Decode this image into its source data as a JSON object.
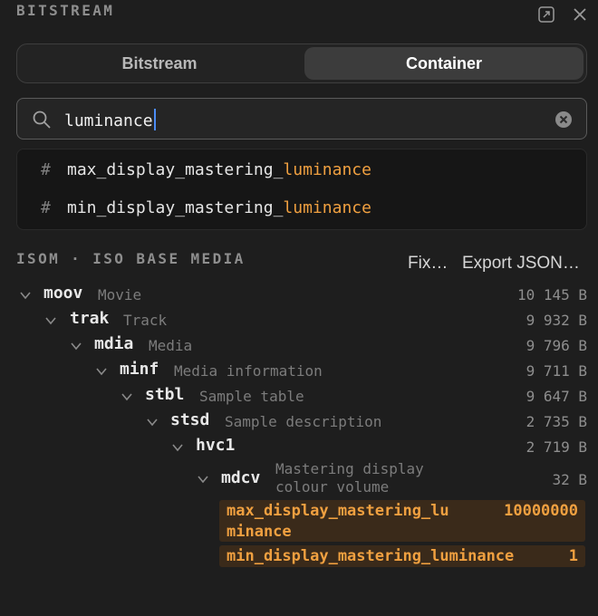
{
  "panel": {
    "title": "BITSTREAM",
    "icons": {
      "detach": "external-window-icon",
      "close": "close-icon"
    }
  },
  "tabs": [
    {
      "label": "Bitstream",
      "active": false
    },
    {
      "label": "Container",
      "active": true
    }
  ],
  "search": {
    "value": "luminance",
    "icons": {
      "search": "magnifier-icon",
      "clear": "clear-circle-icon"
    }
  },
  "suggestions": [
    {
      "prefix": "max_display_mastering_",
      "match": "luminance",
      "icon": "hash"
    },
    {
      "prefix": "min_display_mastering_",
      "match": "luminance",
      "icon": "hash"
    }
  ],
  "tree_header": {
    "title": "ISOM · ISO BASE MEDIA",
    "fix_label": "Fix…",
    "export_label": "Export JSON…"
  },
  "tree": [
    {
      "name": "moov",
      "desc": "Movie",
      "size": "10 145 B"
    },
    {
      "name": "trak",
      "desc": "Track",
      "size": "9 932 B"
    },
    {
      "name": "mdia",
      "desc": "Media",
      "size": "9 796 B"
    },
    {
      "name": "minf",
      "desc": "Media information",
      "size": "9 711 B"
    },
    {
      "name": "stbl",
      "desc": "Sample table",
      "size": "9 647 B"
    },
    {
      "name": "stsd",
      "desc": "Sample description",
      "size": "2 735 B"
    },
    {
      "name": "hvc1",
      "desc": "",
      "size": "2 719 B"
    },
    {
      "name": "mdcv",
      "desc": "Mastering display colour volume",
      "size": "32 B"
    }
  ],
  "fields": [
    {
      "name_line1": "max_display_mastering_lu",
      "name_line2": "minance",
      "value": "10000000"
    },
    {
      "name": "min_display_mastering_luminance",
      "value": "1"
    }
  ],
  "colors": {
    "accent": "#f0a040",
    "caret": "#4c8cf5",
    "background": "#1e1e1e"
  }
}
